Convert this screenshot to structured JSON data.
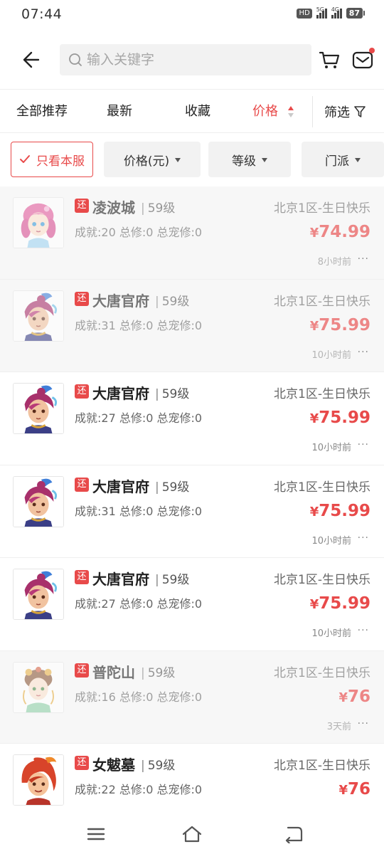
{
  "status": {
    "time": "07:44",
    "hd": "HD",
    "net1": "5G",
    "net2": "4G",
    "battery": "87"
  },
  "search": {
    "placeholder": "输入关键字"
  },
  "sort_tabs": [
    {
      "label": "全部推荐"
    },
    {
      "label": "最新"
    },
    {
      "label": "收藏"
    },
    {
      "label": "价格",
      "active": true
    }
  ],
  "filter_label": "筛选",
  "chips": [
    {
      "label": "只看本服",
      "selected": true
    },
    {
      "label": "价格(元)"
    },
    {
      "label": "等级"
    },
    {
      "label": "门派"
    }
  ],
  "tag_label": "还",
  "listings": [
    {
      "name": "凌波城",
      "level": "59级",
      "stats": "成就:20 总修:0 总宠修:0",
      "server": "北京1区-生日快乐",
      "price": "74.99",
      "time": "8小时前",
      "dim": true,
      "avatar": "avatar-pink-girl"
    },
    {
      "name": "大唐官府",
      "level": "59级",
      "stats": "成就:31 总修:0 总宠修:0",
      "server": "北京1区-生日快乐",
      "price": "75.99",
      "time": "10小时前",
      "dim": true,
      "avatar": "avatar-red-warrior"
    },
    {
      "name": "大唐官府",
      "level": "59级",
      "stats": "成就:27 总修:0 总宠修:0",
      "server": "北京1区-生日快乐",
      "price": "75.99",
      "time": "10小时前",
      "dim": false,
      "avatar": "avatar-red-warrior"
    },
    {
      "name": "大唐官府",
      "level": "59级",
      "stats": "成就:31 总修:0 总宠修:0",
      "server": "北京1区-生日快乐",
      "price": "75.99",
      "time": "10小时前",
      "dim": false,
      "avatar": "avatar-red-warrior"
    },
    {
      "name": "大唐官府",
      "level": "59级",
      "stats": "成就:27 总修:0 总宠修:0",
      "server": "北京1区-生日快乐",
      "price": "75.99",
      "time": "10小时前",
      "dim": false,
      "avatar": "avatar-red-warrior"
    },
    {
      "name": "普陀山",
      "level": "59级",
      "stats": "成就:16 总修:0 总宠修:0",
      "server": "北京1区-生日快乐",
      "price": "76",
      "time": "3天前",
      "dim": true,
      "avatar": "avatar-fairy-girl"
    },
    {
      "name": "女魃墓",
      "level": "59级",
      "stats": "成就:22 总修:0 总宠修:0",
      "server": "北京1区-生日快乐",
      "price": "76",
      "time": "",
      "dim": false,
      "avatar": "avatar-fire-girl"
    }
  ],
  "currency": "¥",
  "colors": {
    "accent": "#e84a4a",
    "text": "#222222",
    "muted": "#888888",
    "chip_bg": "#f2f2f2"
  }
}
